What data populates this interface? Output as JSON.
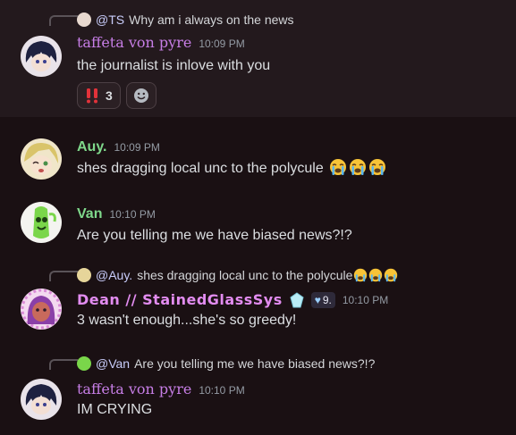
{
  "messages": [
    {
      "reply": {
        "mention": "@TS",
        "text": "Why am i always on the news"
      },
      "author": "taffeta von pyre",
      "time": "10:09 PM",
      "text": "the journalist is inlove with you",
      "reactions": [
        {
          "emoji": "double-exclamation",
          "count": "3"
        }
      ],
      "name_color": "#c77ee6"
    },
    {
      "author": "Auy.",
      "time": "10:09 PM",
      "text": "shes dragging local unc to the polycule",
      "emojis": [
        "sob",
        "sob",
        "sob"
      ],
      "name_color": "#7fd88b"
    },
    {
      "author": "Van",
      "time": "10:10 PM",
      "text": "Are you telling me we have biased news?!?",
      "name_color": "#7fd88b"
    },
    {
      "reply": {
        "mention": "@Auy.",
        "text": "shes dragging local unc to the polycule"
      },
      "author": "Dean // StainedGlassSys",
      "badge": "9.",
      "time": "10:10 PM",
      "text": "3 wasn't enough...she's so greedy!",
      "name_color": "#e28cf0"
    },
    {
      "reply": {
        "mention": "@Van",
        "text": "Are you telling me we have biased news?!?"
      },
      "author": "taffeta von pyre",
      "time": "10:10 PM",
      "text": "IM CRYING",
      "name_color": "#c77ee6"
    }
  ],
  "colors": {
    "background": "#1a1013",
    "highlight": "#23191d",
    "timestamp": "#949ba4"
  }
}
